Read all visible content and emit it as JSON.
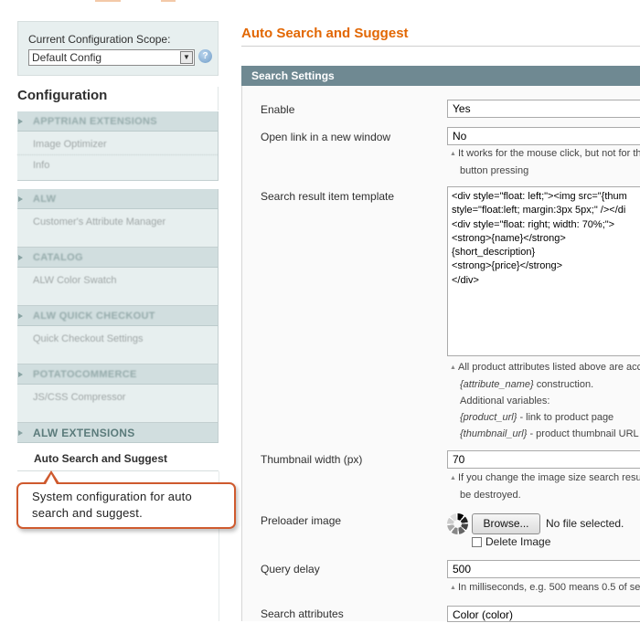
{
  "scope": {
    "label": "Current Configuration Scope:",
    "selected": "Default Config",
    "help_glyph": "?"
  },
  "sidebar": {
    "title": "Configuration",
    "groups": [
      {
        "title": "APPTRIAN EXTENSIONS",
        "items": [
          "Image Optimizer",
          "Info"
        ]
      },
      {
        "title": "ALW",
        "items": [
          "Customer's Attribute Manager"
        ]
      },
      {
        "title": "CATALOG",
        "items": [
          "ALW Color Swatch"
        ]
      },
      {
        "title": "ALW QUICK CHECKOUT",
        "items": [
          "Quick Checkout Settings"
        ]
      },
      {
        "title": "POTATOCOMMERCE",
        "items": [
          "JS/CSS Compressor"
        ]
      }
    ],
    "current_group": "ALW EXTENSIONS",
    "active_item": "Auto Search and Suggest"
  },
  "callout": {
    "text": "System configuration for auto search and suggest."
  },
  "page": {
    "title": "Auto Search and Suggest",
    "section_title": "Search Settings"
  },
  "fields": {
    "enable": {
      "label": "Enable",
      "value": "Yes"
    },
    "open_link": {
      "label": "Open link in a new window",
      "value": "No",
      "note_line1": "It works for the mouse click, but not for th",
      "note_line2": "button pressing"
    },
    "template": {
      "label": "Search result item template",
      "value": "<div style=\"float: left;\"><img src=\"{thum\nstyle=\"float:left; margin:3px 5px;\" /></di\n<div style=\"float: right; width: 70%;\">\n<strong>{name}</strong>\n{short_description}\n<strong>{price}</strong>\n</div>",
      "note_line1": "All product attributes listed above are acc",
      "note_line2_italic": "{attribute_name}",
      "note_line2_rest": " construction.",
      "note_line3": "Additional variables:",
      "note_line4_italic": "{product_url}",
      "note_line4_rest": " - link to product page",
      "note_line5_italic": "{thumbnail_url}",
      "note_line5_rest": " - product thumbnail URL"
    },
    "thumbnail_width": {
      "label": "Thumbnail width (px)",
      "value": "70",
      "note_line1": "If you change the image size search resu",
      "note_line2": "be destroyed."
    },
    "preloader": {
      "label": "Preloader image",
      "browse_label": "Browse...",
      "no_file": "No file selected.",
      "delete_label": "Delete Image"
    },
    "query_delay": {
      "label": "Query delay",
      "value": "500",
      "note_line1": "In milliseconds, e.g. 500 means 0.5 of sec"
    },
    "search_attributes": {
      "label": "Search attributes",
      "value": "Color (color)"
    }
  },
  "colors": {
    "accent": "#e26703",
    "section_header": "#6f8992",
    "sidebar_bg": "#e7efef",
    "callout_border": "#cf5a2e"
  }
}
